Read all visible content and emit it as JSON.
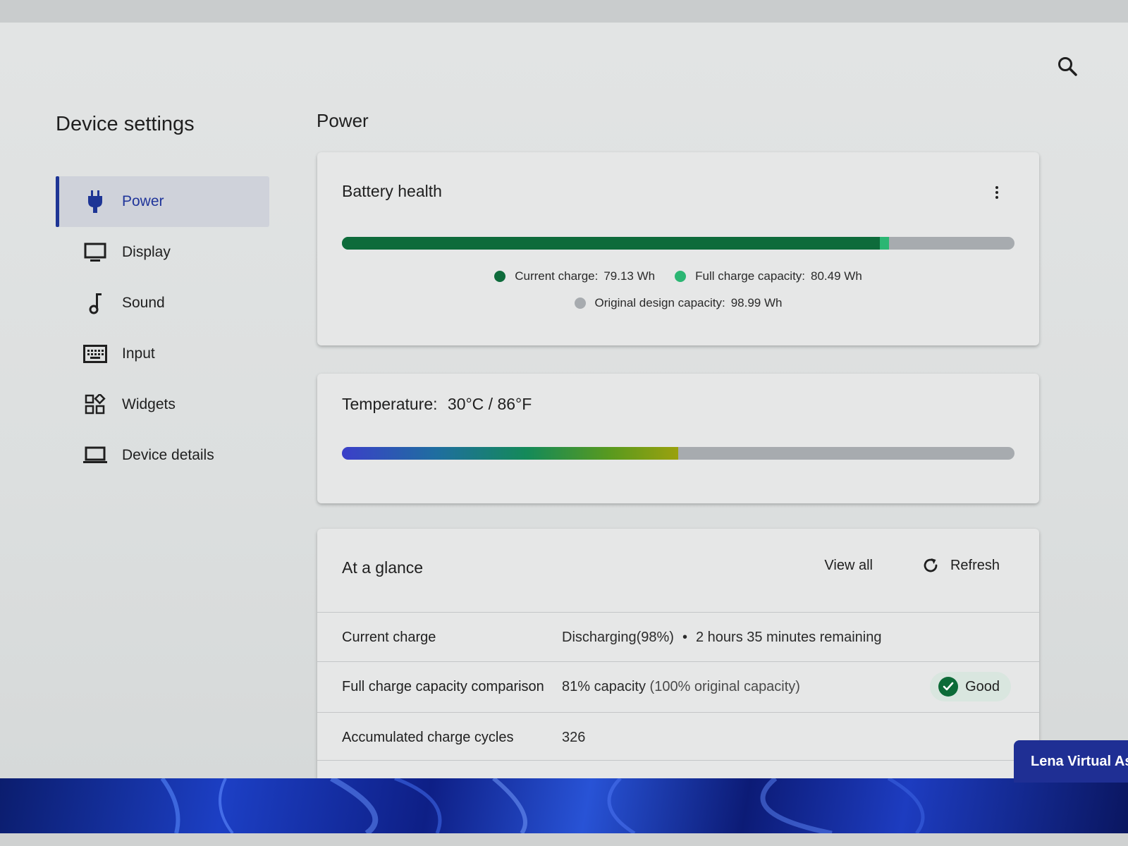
{
  "app": {
    "nav_title": "Device settings",
    "page_title": "Power"
  },
  "nav": {
    "items": [
      {
        "label": "Power",
        "icon": "plug-icon",
        "active": true
      },
      {
        "label": "Display",
        "icon": "monitor-icon"
      },
      {
        "label": "Sound",
        "icon": "music-note-icon"
      },
      {
        "label": "Input",
        "icon": "keyboard-icon"
      },
      {
        "label": "Widgets",
        "icon": "widgets-icon"
      },
      {
        "label": "Device details",
        "icon": "laptop-icon"
      }
    ]
  },
  "battery_health": {
    "title": "Battery health",
    "current_charge_wh": 79.13,
    "full_charge_capacity_wh": 80.49,
    "design_capacity_wh": 98.99,
    "legend": {
      "current_label": "Current charge:",
      "current_value": "79.13 Wh",
      "full_label": "Full charge capacity:",
      "full_value": "80.49 Wh",
      "design_label": "Original design capacity:",
      "design_value": "98.99 Wh"
    }
  },
  "temperature": {
    "title": "Temperature:",
    "value": "30°C / 86°F",
    "level_fraction": 0.5
  },
  "glance": {
    "title": "At a glance",
    "view_all": "View all",
    "refresh": "Refresh",
    "rows": [
      {
        "label": "Current charge",
        "value": "Discharging(98%)",
        "sep": "•",
        "extra": "2 hours 35 minutes remaining"
      },
      {
        "label": "Full charge capacity comparison",
        "value": "81% capacity",
        "extra": "(100% original capacity)",
        "badge": "Good"
      },
      {
        "label": "Accumulated charge cycles",
        "value": "326"
      }
    ]
  },
  "assistant": {
    "label": "Lena Virtual As"
  },
  "colors": {
    "accent": "#1e3595",
    "current_charge": "#0e6b3b",
    "full_charge": "#2bb673",
    "design_capacity": "#a7abaf",
    "good": "#0d6b38"
  }
}
